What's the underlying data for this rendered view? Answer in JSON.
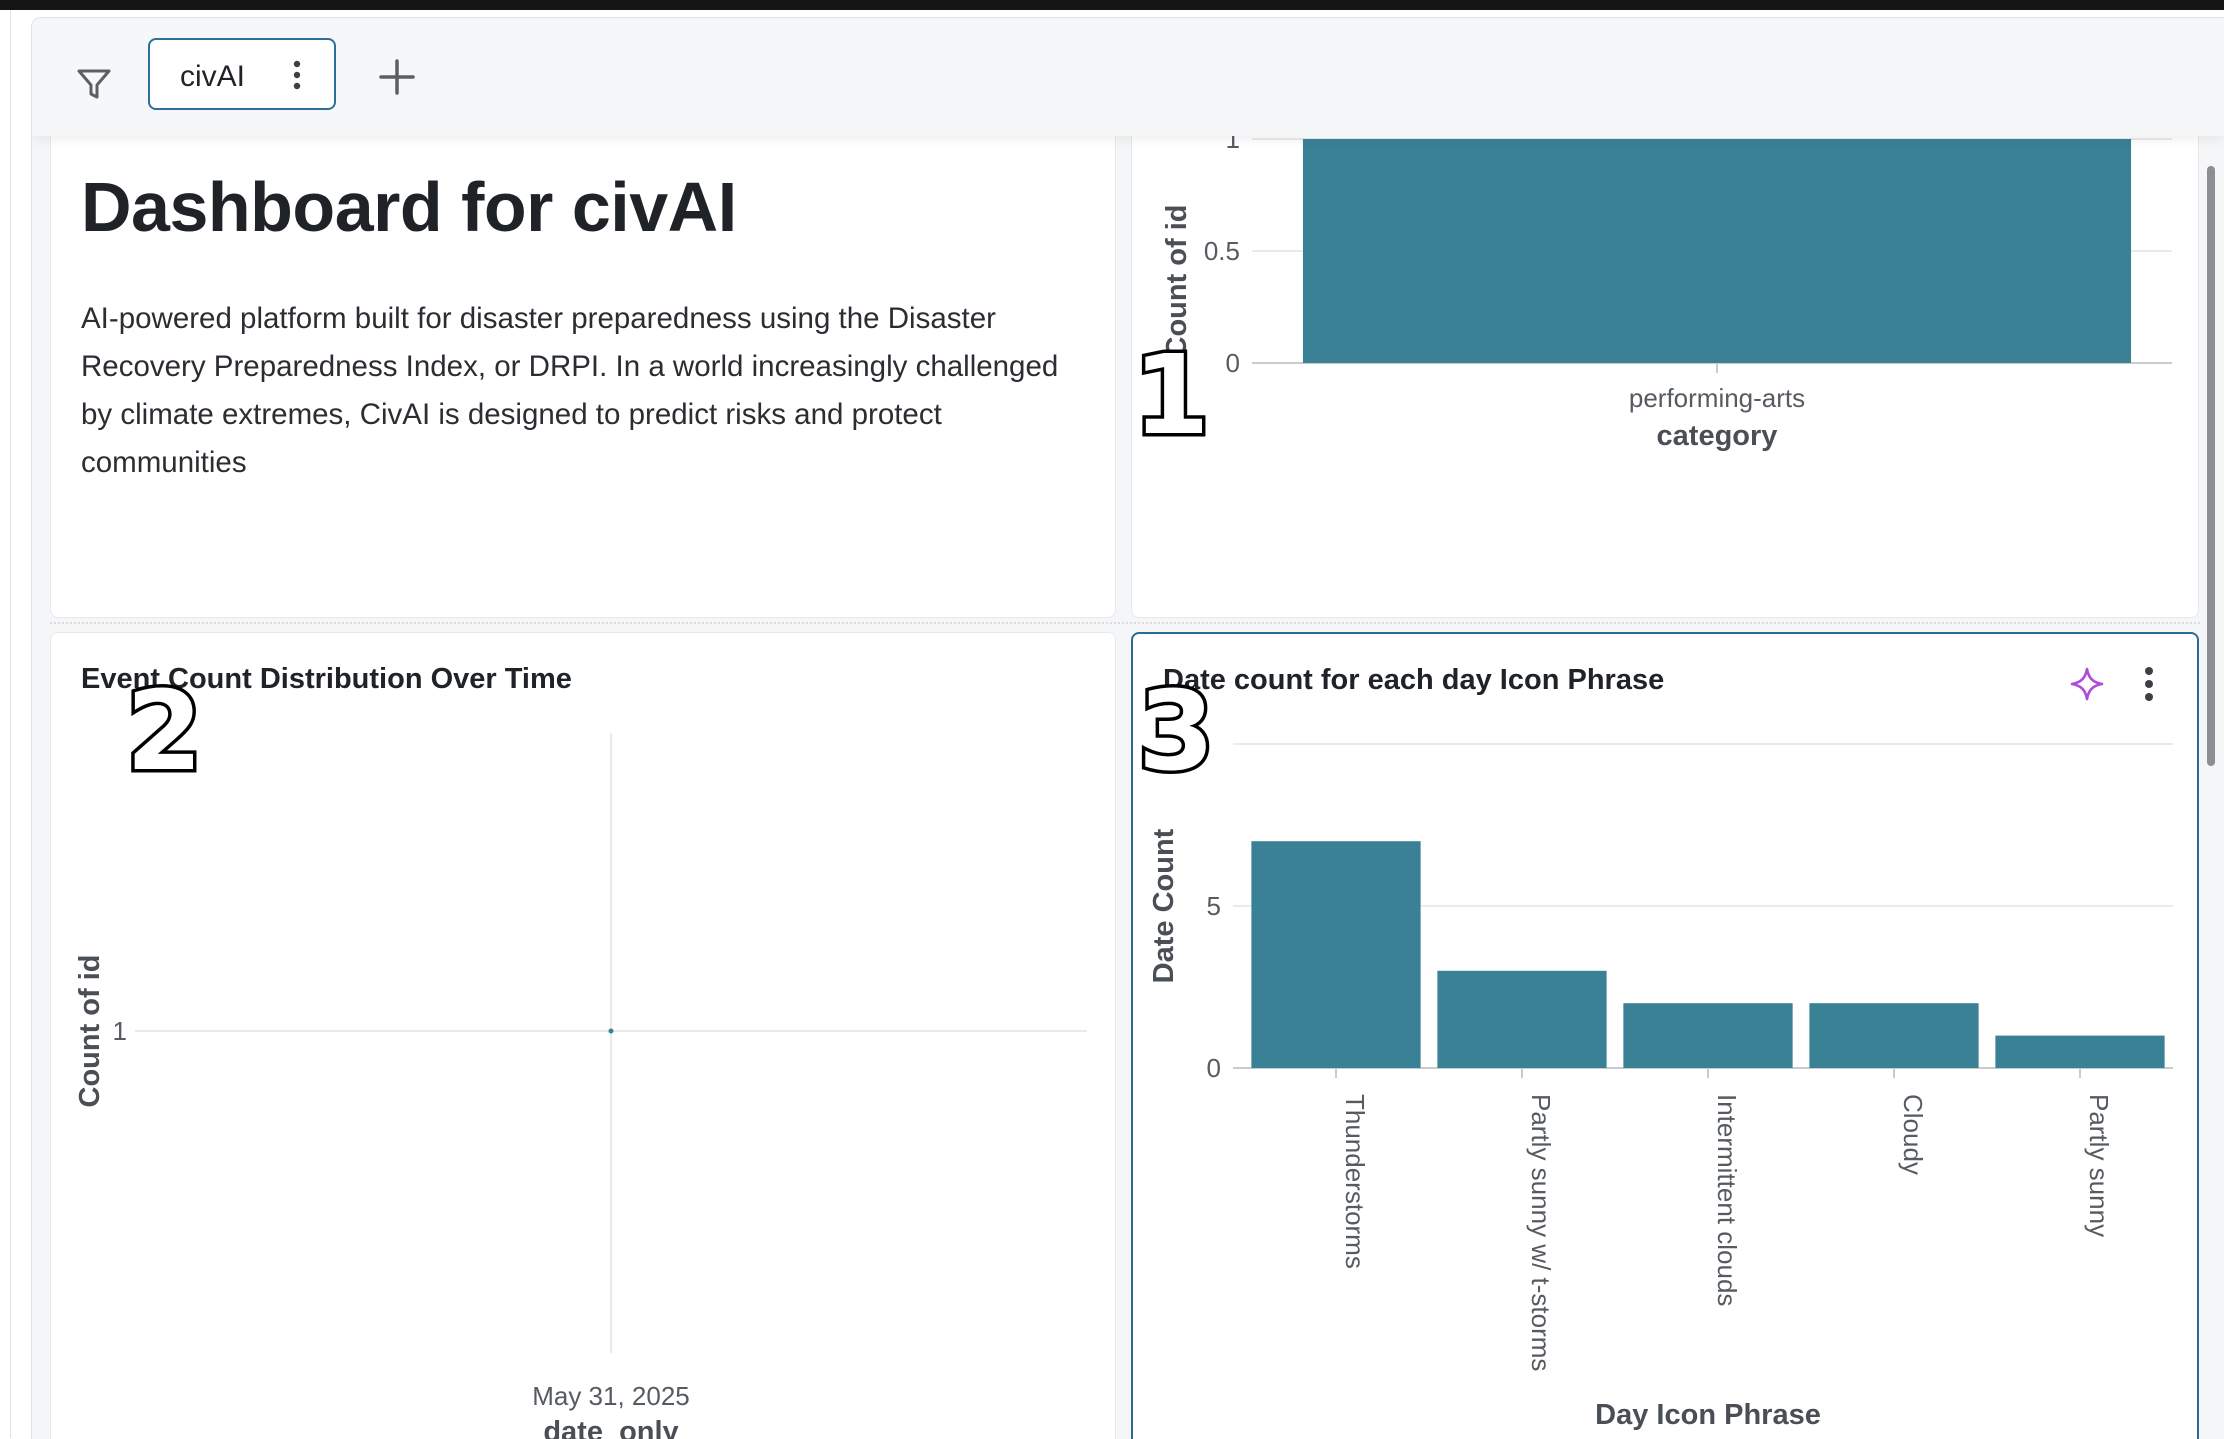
{
  "toolbar": {
    "tab_label": "civAI"
  },
  "intro": {
    "title": "Dashboard for civAI",
    "description": "AI-powered platform built for disaster preparedness using the Disaster Recovery Preparedness Index, or DRPI. In a world increasingly challenged by climate extremes, CivAI is designed to predict risks and protect communities"
  },
  "markers": [
    "1",
    "2",
    "3"
  ],
  "icons": {
    "filter": "filter-icon",
    "tab_menu": "more-vertical-icon",
    "add": "plus-icon",
    "ai": "sparkle-icon",
    "card_menu": "more-vertical-icon"
  },
  "colors": {
    "bar": "#3a8196",
    "selected_border": "#2b6c95",
    "ai_sparkle": "#b04ad8"
  },
  "chart_data": [
    {
      "id": "category-chart",
      "type": "bar",
      "title": "",
      "xlabel": "category",
      "ylabel": "Count of id",
      "categories": [
        "performing-arts"
      ],
      "values": [
        1
      ],
      "ylim": [
        0,
        1
      ],
      "yticks": [
        "0",
        "0.5",
        "1"
      ],
      "grid": true
    },
    {
      "id": "time-chart",
      "type": "scatter",
      "title": "Event Count Distribution Over Time",
      "xlabel": "date_only",
      "ylabel": "Count of id",
      "x": [
        "May 31, 2025"
      ],
      "y": [
        1
      ],
      "yticks": [
        "1"
      ],
      "grid": true
    },
    {
      "id": "day-icon-chart",
      "type": "bar",
      "title": "Date count for each day Icon Phrase",
      "xlabel": "Day Icon Phrase",
      "ylabel": "Date Count",
      "categories": [
        "Thunderstorms",
        "Partly sunny w/ t-storms",
        "Intermittent clouds",
        "Cloudy",
        "Partly sunny"
      ],
      "values": [
        7,
        3,
        2,
        2,
        1
      ],
      "ylim": [
        0,
        10
      ],
      "yticks": [
        "0",
        "5"
      ],
      "grid": true
    }
  ]
}
